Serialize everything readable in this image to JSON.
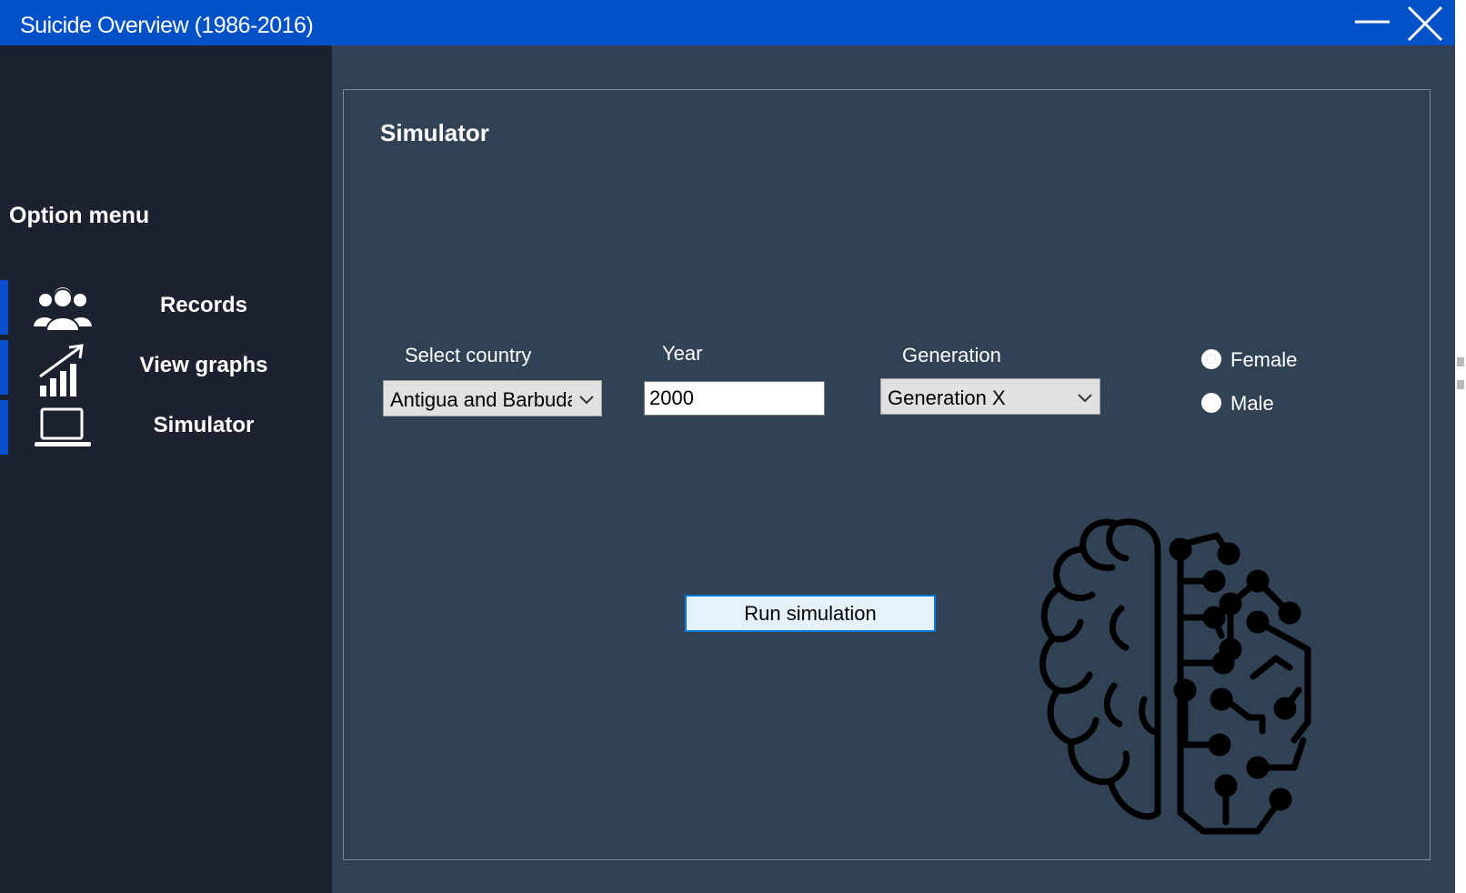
{
  "window": {
    "title": "Suicide Overview (1986-2016)",
    "controls": [
      "minimize-icon",
      "close-icon"
    ]
  },
  "sidebar": {
    "heading": "Option menu",
    "items": [
      {
        "label": "Records",
        "icon": "users-icon"
      },
      {
        "label": "View graphs",
        "icon": "chart-icon"
      },
      {
        "label": "Simulator",
        "icon": "laptop-icon"
      }
    ]
  },
  "simulator": {
    "title": "Simulator",
    "country": {
      "label": "Select country",
      "value": "Antigua and Barbuda"
    },
    "year": {
      "label": "Year",
      "value": "2000"
    },
    "generation": {
      "label": "Generation",
      "value": "Generation X"
    },
    "sex": {
      "options": [
        {
          "label": "Female",
          "checked": true
        },
        {
          "label": "Male",
          "checked": false
        }
      ]
    },
    "run_button": "Run simulation",
    "illustration": "brain-circuit-icon"
  },
  "colors": {
    "titlebar": "#0050c8",
    "sidebar": "#1c2230",
    "main": "#314255",
    "accent": "#0a4fd0"
  }
}
